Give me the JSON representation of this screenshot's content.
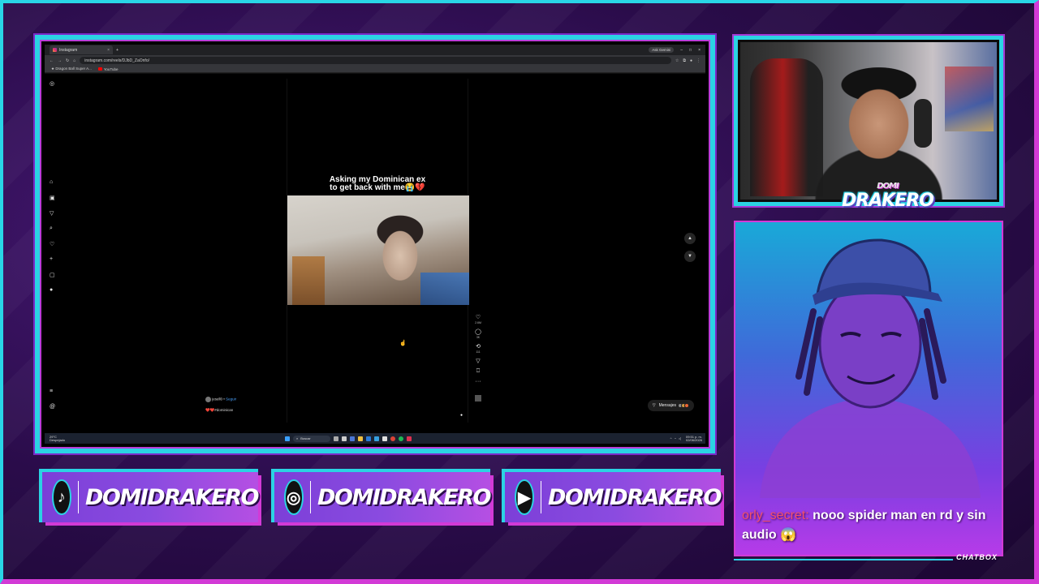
{
  "browser": {
    "tab_title": "Instagram",
    "tab_close": "×",
    "new_tab": "+",
    "ask_gemini": "Ask Gemini",
    "window_controls": [
      "–",
      "□",
      "×"
    ],
    "url": "instagram.com/reels/DJbD_ZaOnfo/",
    "bookmarks": [
      "Dragon Ball Super A...",
      "YouTube"
    ]
  },
  "reel": {
    "caption_line1": "Asking my Dominican ex",
    "caption_line2": "to get back with me😭💔",
    "likes": "2.6M",
    "comments": "3K",
    "shares": "111",
    "author": "jesell0 • ",
    "follow": "Seguir",
    "hashtag": "❤️❤️#dominican",
    "messages_label": "Mensajes"
  },
  "ig_sidebar_icons": [
    "instagram-icon",
    "home-icon",
    "reels-icon",
    "explore-icon",
    "search-icon",
    "heart-icon",
    "create-icon",
    "dashboard-icon",
    "profile-icon",
    "menu-icon",
    "threads-icon"
  ],
  "taskbar": {
    "temp": "29°C",
    "weather": "Despejado",
    "search": "Buscar",
    "time": "09:51 p. m.",
    "date": "02/06/2026"
  },
  "cam_logo": {
    "small": "DOMI",
    "big": "DRAKERO"
  },
  "chat": {
    "user": "orly_secret:",
    "message": "nooo spider man en rd y sin audio 😱"
  },
  "chatbox_label": "CHATBOX",
  "socials": [
    {
      "platform": "tiktok",
      "icon": "♪",
      "name": "DOMIDRAKERO"
    },
    {
      "platform": "instagram",
      "icon": "◎",
      "name": "DOMIDRAKERO"
    },
    {
      "platform": "youtube",
      "icon": "▶",
      "name": "DOMIDRAKERO"
    }
  ],
  "colors": {
    "accent_cyan": "#2bd3e3",
    "accent_magenta": "#d23ad6",
    "panel_purple": "#8a4be0"
  }
}
